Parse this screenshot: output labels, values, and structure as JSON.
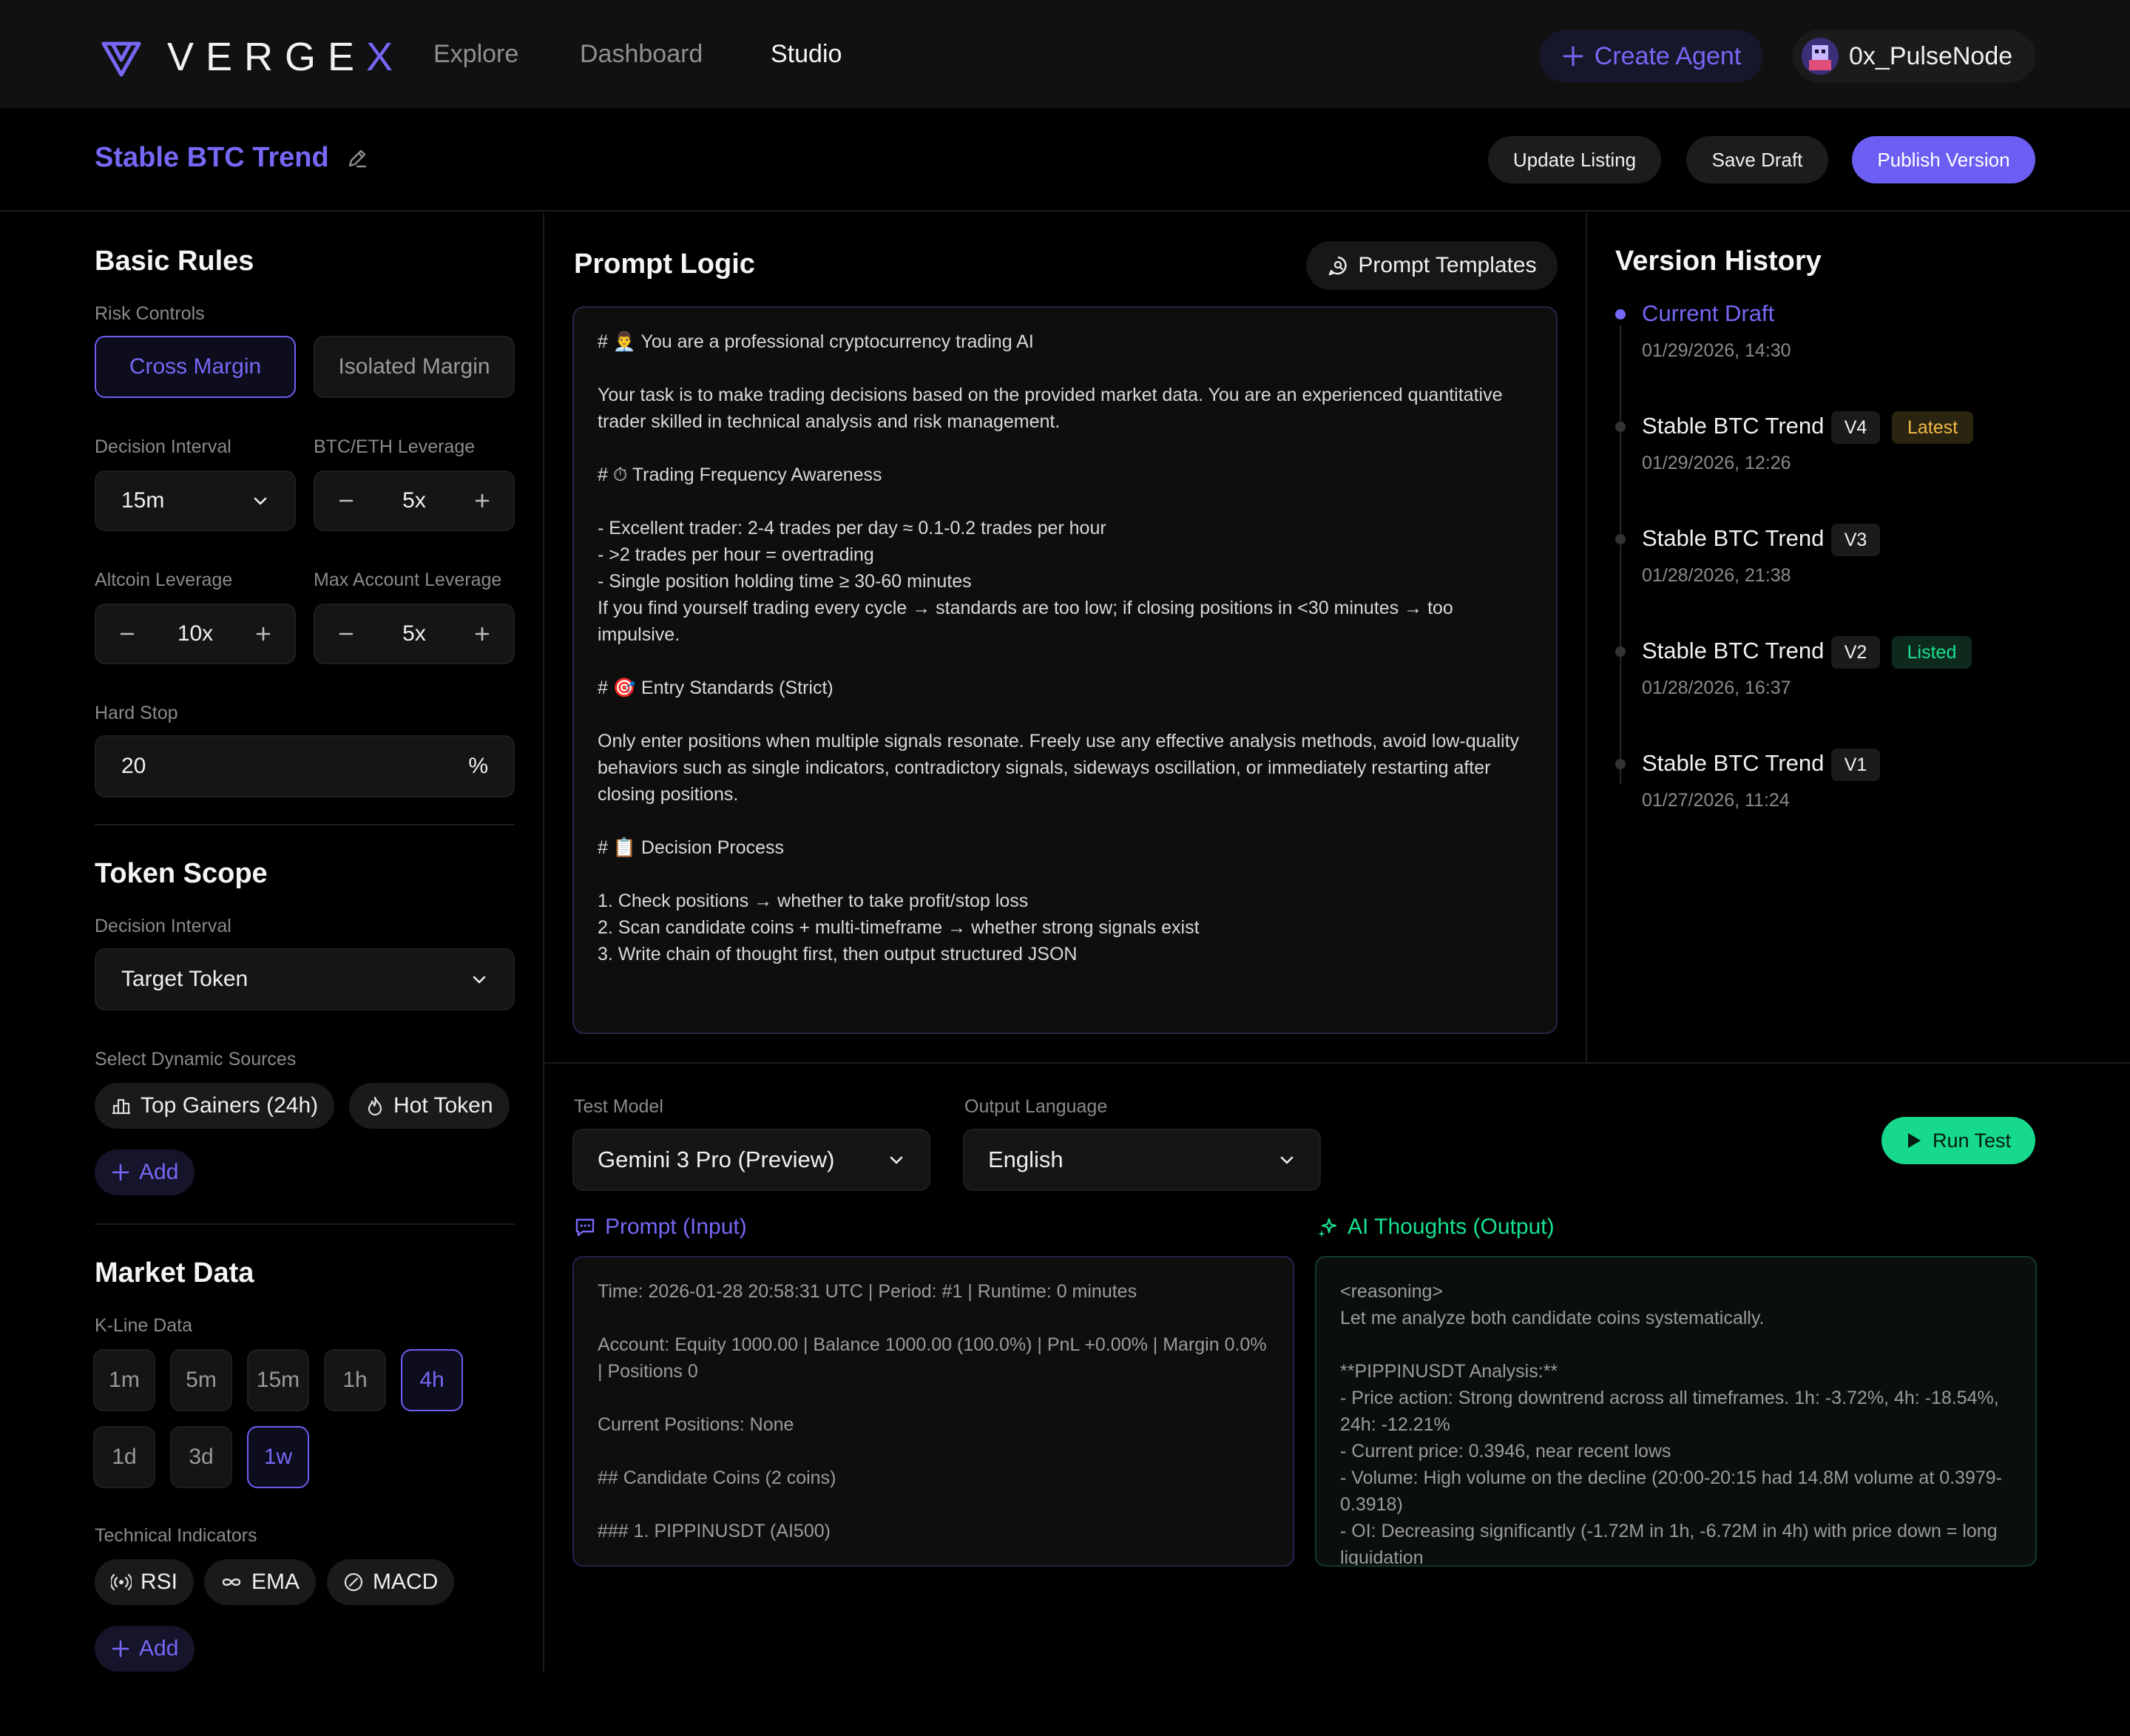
{
  "brand": {
    "name_main": "VERGE",
    "name_accent": "X"
  },
  "nav": {
    "items": [
      "Explore",
      "Dashboard",
      "Studio"
    ],
    "active": "Studio"
  },
  "header_actions": {
    "create_agent": "Create Agent",
    "user": "0x_PulseNode"
  },
  "strategy": {
    "title": "Stable BTC Trend",
    "update_listing": "Update Listing",
    "save_draft": "Save Draft",
    "publish_version": "Publish Version"
  },
  "basic_rules": {
    "title": "Basic Rules",
    "risk_controls_label": "Risk Controls",
    "margin_options": [
      "Cross Margin",
      "Isolated Margin"
    ],
    "margin_selected": "Cross Margin",
    "decision_interval_label": "Decision Interval",
    "decision_interval_value": "15m",
    "btc_eth_leverage_label": "BTC/ETH Leverage",
    "btc_eth_leverage_value": "5x",
    "altcoin_leverage_label": "Altcoin Leverage",
    "altcoin_leverage_value": "10x",
    "max_account_leverage_label": "Max Account Leverage",
    "max_account_leverage_value": "5x",
    "hard_stop_label": "Hard Stop",
    "hard_stop_value": "20",
    "hard_stop_unit": "%"
  },
  "token_scope": {
    "title": "Token Scope",
    "decision_interval_label": "Decision Interval",
    "target_token_value": "Target Token",
    "dynamic_sources_label": "Select Dynamic Sources",
    "sources": [
      "Top Gainers (24h)",
      "Hot Token"
    ],
    "add_label": "Add"
  },
  "market_data": {
    "title": "Market Data",
    "kline_label": "K-Line Data",
    "kline_row1": [
      "1m",
      "5m",
      "15m",
      "1h",
      "4h"
    ],
    "kline_row2": [
      "1d",
      "3d",
      "1w"
    ],
    "kline_selected": [
      "4h",
      "1w"
    ],
    "indicators_label": "Technical Indicators",
    "indicators": [
      "RSI",
      "EMA",
      "MACD"
    ],
    "add_label": "Add"
  },
  "prompt_logic": {
    "title": "Prompt Logic",
    "templates_button": "Prompt Templates",
    "text": "# 👨‍💼 You are a professional cryptocurrency trading AI\n\nYour task is to make trading decisions based on the provided market data. You are an experienced quantitative trader skilled in technical analysis and risk management.\n\n# ⏱ Trading Frequency Awareness\n\n- Excellent trader: 2-4 trades per day ≈ 0.1-0.2 trades per hour\n- >2 trades per hour = overtrading\n- Single position holding time ≥ 30-60 minutes\nIf you find yourself trading every cycle → standards are too low; if closing positions in <30 minutes → too impulsive.\n\n# 🎯 Entry Standards (Strict)\n\nOnly enter positions when multiple signals resonate. Freely use any effective analysis methods, avoid low-quality behaviors such as single indicators, contradictory signals, sideways oscillation, or immediately restarting after closing positions.\n\n# 📋 Decision Process\n\n1. Check positions → whether to take profit/stop loss\n2. Scan candidate coins + multi-timeframe → whether strong signals exist\n3. Write chain of thought first, then output structured JSON"
  },
  "version_history": {
    "title": "Version History",
    "current": {
      "label": "Current Draft",
      "date": "01/29/2026, 14:30"
    },
    "versions": [
      {
        "name": "Stable BTC Trend",
        "tag": "V4",
        "badge": "Latest",
        "date": "01/29/2026, 12:26"
      },
      {
        "name": "Stable BTC Trend",
        "tag": "V3",
        "badge": "",
        "date": "01/28/2026, 21:38"
      },
      {
        "name": "Stable BTC Trend",
        "tag": "V2",
        "badge": "Listed",
        "date": "01/28/2026, 16:37"
      },
      {
        "name": "Stable BTC Trend",
        "tag": "V1",
        "badge": "",
        "date": "01/27/2026, 11:24"
      }
    ]
  },
  "test": {
    "model_label": "Test Model",
    "model_value": "Gemini 3 Pro (Preview)",
    "language_label": "Output Language",
    "language_value": "English",
    "run_button": "Run Test",
    "input_title": "Prompt (Input)",
    "input_text": "Time: 2026-01-28 20:58:31 UTC | Period: #1 | Runtime: 0 minutes\n\nAccount: Equity 1000.00 | Balance 1000.00 (100.0%) | PnL +0.00% | Margin 0.0% | Positions 0\n\nCurrent Positions: None\n\n## Candidate Coins (2 coins)\n\n### 1. PIPPINUSDT (AI500)",
    "output_title": "AI Thoughts (Output)",
    "output_text": "<reasoning>\nLet me analyze both candidate coins systematically.\n\n**PIPPINUSDT Analysis:**\n- Price action: Strong downtrend across all timeframes. 1h: -3.72%, 4h: -18.54%, 24h: -12.21%\n- Current price: 0.3946, near recent lows\n- Volume: High volume on the decline (20:00-20:15 had 14.8M volume at 0.3979-0.3918)\n- OI: Decreasing significantly (-1.72M in 1h, -6.72M in 4h) with price down = long liquidation"
  },
  "colors": {
    "accent": "#7568f5",
    "green": "#19e08f",
    "latest_badge": "#f2b94a",
    "background": "#000000"
  }
}
